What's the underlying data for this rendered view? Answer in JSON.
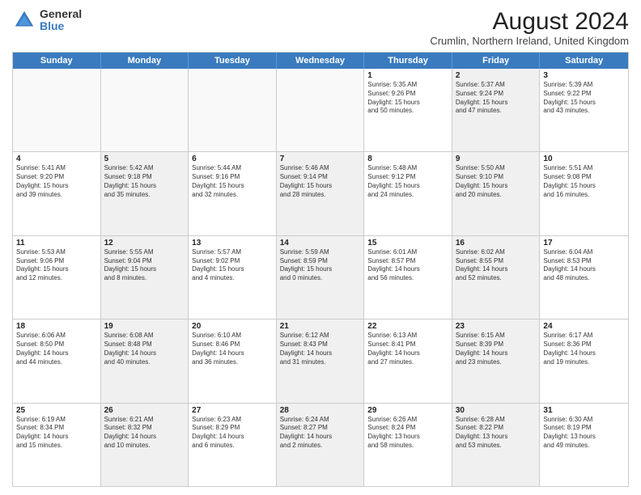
{
  "logo": {
    "general": "General",
    "blue": "Blue"
  },
  "title": "August 2024",
  "subtitle": "Crumlin, Northern Ireland, United Kingdom",
  "headers": [
    "Sunday",
    "Monday",
    "Tuesday",
    "Wednesday",
    "Thursday",
    "Friday",
    "Saturday"
  ],
  "weeks": [
    [
      {
        "day": "",
        "text": "",
        "empty": true
      },
      {
        "day": "",
        "text": "",
        "empty": true
      },
      {
        "day": "",
        "text": "",
        "empty": true
      },
      {
        "day": "",
        "text": "",
        "empty": true
      },
      {
        "day": "1",
        "text": "Sunrise: 5:35 AM\nSunset: 9:26 PM\nDaylight: 15 hours\nand 50 minutes."
      },
      {
        "day": "2",
        "text": "Sunrise: 5:37 AM\nSunset: 9:24 PM\nDaylight: 15 hours\nand 47 minutes.",
        "shaded": true
      },
      {
        "day": "3",
        "text": "Sunrise: 5:39 AM\nSunset: 9:22 PM\nDaylight: 15 hours\nand 43 minutes."
      }
    ],
    [
      {
        "day": "4",
        "text": "Sunrise: 5:41 AM\nSunset: 9:20 PM\nDaylight: 15 hours\nand 39 minutes."
      },
      {
        "day": "5",
        "text": "Sunrise: 5:42 AM\nSunset: 9:18 PM\nDaylight: 15 hours\nand 35 minutes.",
        "shaded": true
      },
      {
        "day": "6",
        "text": "Sunrise: 5:44 AM\nSunset: 9:16 PM\nDaylight: 15 hours\nand 32 minutes."
      },
      {
        "day": "7",
        "text": "Sunrise: 5:46 AM\nSunset: 9:14 PM\nDaylight: 15 hours\nand 28 minutes.",
        "shaded": true
      },
      {
        "day": "8",
        "text": "Sunrise: 5:48 AM\nSunset: 9:12 PM\nDaylight: 15 hours\nand 24 minutes."
      },
      {
        "day": "9",
        "text": "Sunrise: 5:50 AM\nSunset: 9:10 PM\nDaylight: 15 hours\nand 20 minutes.",
        "shaded": true
      },
      {
        "day": "10",
        "text": "Sunrise: 5:51 AM\nSunset: 9:08 PM\nDaylight: 15 hours\nand 16 minutes."
      }
    ],
    [
      {
        "day": "11",
        "text": "Sunrise: 5:53 AM\nSunset: 9:06 PM\nDaylight: 15 hours\nand 12 minutes."
      },
      {
        "day": "12",
        "text": "Sunrise: 5:55 AM\nSunset: 9:04 PM\nDaylight: 15 hours\nand 8 minutes.",
        "shaded": true
      },
      {
        "day": "13",
        "text": "Sunrise: 5:57 AM\nSunset: 9:02 PM\nDaylight: 15 hours\nand 4 minutes."
      },
      {
        "day": "14",
        "text": "Sunrise: 5:59 AM\nSunset: 8:59 PM\nDaylight: 15 hours\nand 0 minutes.",
        "shaded": true
      },
      {
        "day": "15",
        "text": "Sunrise: 6:01 AM\nSunset: 8:57 PM\nDaylight: 14 hours\nand 56 minutes."
      },
      {
        "day": "16",
        "text": "Sunrise: 6:02 AM\nSunset: 8:55 PM\nDaylight: 14 hours\nand 52 minutes.",
        "shaded": true
      },
      {
        "day": "17",
        "text": "Sunrise: 6:04 AM\nSunset: 8:53 PM\nDaylight: 14 hours\nand 48 minutes."
      }
    ],
    [
      {
        "day": "18",
        "text": "Sunrise: 6:06 AM\nSunset: 8:50 PM\nDaylight: 14 hours\nand 44 minutes."
      },
      {
        "day": "19",
        "text": "Sunrise: 6:08 AM\nSunset: 8:48 PM\nDaylight: 14 hours\nand 40 minutes.",
        "shaded": true
      },
      {
        "day": "20",
        "text": "Sunrise: 6:10 AM\nSunset: 8:46 PM\nDaylight: 14 hours\nand 36 minutes."
      },
      {
        "day": "21",
        "text": "Sunrise: 6:12 AM\nSunset: 8:43 PM\nDaylight: 14 hours\nand 31 minutes.",
        "shaded": true
      },
      {
        "day": "22",
        "text": "Sunrise: 6:13 AM\nSunset: 8:41 PM\nDaylight: 14 hours\nand 27 minutes."
      },
      {
        "day": "23",
        "text": "Sunrise: 6:15 AM\nSunset: 8:39 PM\nDaylight: 14 hours\nand 23 minutes.",
        "shaded": true
      },
      {
        "day": "24",
        "text": "Sunrise: 6:17 AM\nSunset: 8:36 PM\nDaylight: 14 hours\nand 19 minutes."
      }
    ],
    [
      {
        "day": "25",
        "text": "Sunrise: 6:19 AM\nSunset: 8:34 PM\nDaylight: 14 hours\nand 15 minutes."
      },
      {
        "day": "26",
        "text": "Sunrise: 6:21 AM\nSunset: 8:32 PM\nDaylight: 14 hours\nand 10 minutes.",
        "shaded": true
      },
      {
        "day": "27",
        "text": "Sunrise: 6:23 AM\nSunset: 8:29 PM\nDaylight: 14 hours\nand 6 minutes."
      },
      {
        "day": "28",
        "text": "Sunrise: 6:24 AM\nSunset: 8:27 PM\nDaylight: 14 hours\nand 2 minutes.",
        "shaded": true
      },
      {
        "day": "29",
        "text": "Sunrise: 6:26 AM\nSunset: 8:24 PM\nDaylight: 13 hours\nand 58 minutes."
      },
      {
        "day": "30",
        "text": "Sunrise: 6:28 AM\nSunset: 8:22 PM\nDaylight: 13 hours\nand 53 minutes.",
        "shaded": true
      },
      {
        "day": "31",
        "text": "Sunrise: 6:30 AM\nSunset: 8:19 PM\nDaylight: 13 hours\nand 49 minutes."
      }
    ]
  ]
}
